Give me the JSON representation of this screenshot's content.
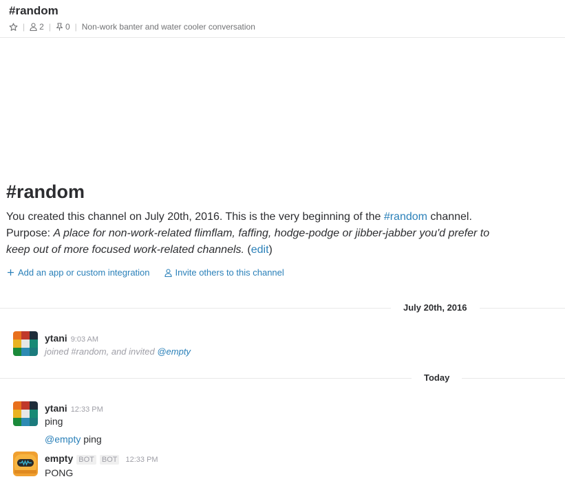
{
  "header": {
    "title": "#random",
    "member_count": "2",
    "pinned_count": "0",
    "purpose": "Non-work banter and water cooler conversation"
  },
  "intro": {
    "title": "#random",
    "created_text": "You created this channel on July 20th, 2016. This is the very beginning of the ",
    "channel_link": "#random",
    "channel_suffix": " channel.",
    "purpose_label": "Purpose: ",
    "purpose_line1": "A place for non-work-related flimflam, faffing, hodge-podge or jibber-jabber you'd prefer to",
    "purpose_line2": "keep out of more focused work-related channels.",
    "edit_open": " (",
    "edit_link": "edit",
    "edit_close": ")",
    "add_app_label": "Add an app or custom integration",
    "invite_label": "Invite others to this channel"
  },
  "dividers": {
    "first": "July 20th, 2016",
    "second": "Today"
  },
  "messages": [
    {
      "user": "ytani",
      "time": "9:03 AM",
      "text_prefix": "joined #random, and invited ",
      "mention": "@empty"
    },
    {
      "user": "ytani",
      "time": "12:33 PM",
      "text": "ping",
      "followup_mention": "@empty",
      "followup_text": " ping"
    },
    {
      "user": "empty",
      "badge1": "BOT",
      "badge2": "BOT",
      "time": "12:33 PM",
      "text": "PONG"
    }
  ],
  "colors": {
    "link": "#2a80b9",
    "muted": "#9e9ea6",
    "text": "#2c2d30"
  }
}
